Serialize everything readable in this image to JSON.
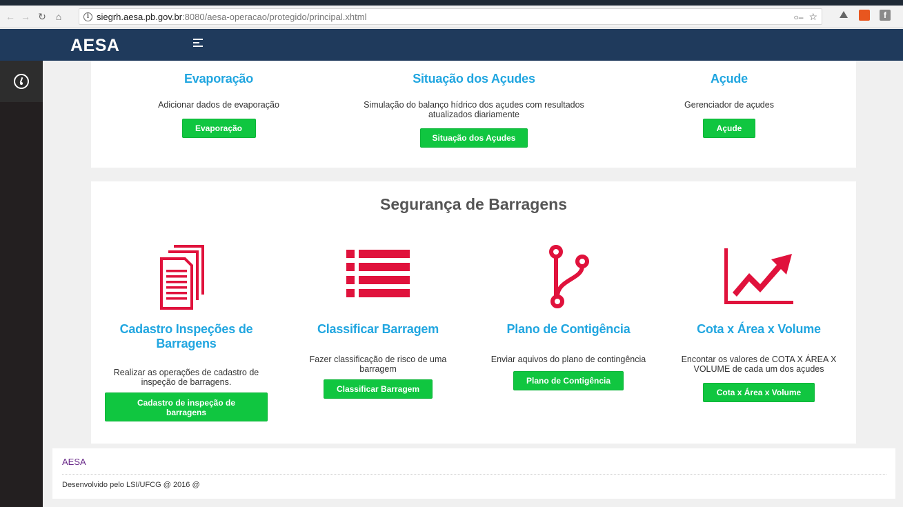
{
  "browser": {
    "url_host": "siegrh.aesa.pb.gov.br",
    "url_rest": ":8080/aesa-operacao/protegido/principal.xhtml"
  },
  "header": {
    "brand": "AESA"
  },
  "top_cards": [
    {
      "title": "Evaporação",
      "desc": "Adicionar dados de evaporação",
      "button": "Evaporação"
    },
    {
      "title": "Situação dos Açudes",
      "desc_line1": "Simulação do balanço hídrico dos açudes com resultados",
      "desc_line2": "atualizados diariamente",
      "button": "Situação dos Açudes"
    },
    {
      "title": "Açude",
      "desc": "Gerenciador de açudes",
      "button": "Açude"
    }
  ],
  "safety": {
    "title": "Segurança de Barragens",
    "items": [
      {
        "icon": "documents-icon",
        "title_line1": "Cadastro Inspeções de",
        "title_line2": "Barragens",
        "desc_line1": "Realizar as operações de cadastro de",
        "desc_line2": "inspeção de barragens.",
        "button_line1": "Cadastro de inspeção de",
        "button_line2": "barragens"
      },
      {
        "icon": "list-icon",
        "title_line1": "Classificar Barragem",
        "desc_line1": "Fazer classificação de risco de uma",
        "desc_line2": "barragem",
        "button_line1": "Classificar Barragem"
      },
      {
        "icon": "branch-icon",
        "title_line1": "Plano de Contigência",
        "desc_line1": "Enviar aquivos do plano de contingência",
        "button_line1": "Plano de Contigência"
      },
      {
        "icon": "line-chart-icon",
        "title_line1": "Cota x Área x Volume",
        "desc_line1": "Encontar os valores de COTA X ÁREA X",
        "desc_line2": "VOLUME de cada um dos açudes",
        "button_line1": "Cota x Área x Volume"
      }
    ]
  },
  "footer": {
    "brand": "AESA",
    "credit": "Desenvolvido pelo LSI/UFCG @ 2016 @"
  },
  "colors": {
    "header_bg": "#1f3a5c",
    "title_blue": "#21a6e0",
    "button_green": "#10c640",
    "icon_red": "#e0123c"
  }
}
